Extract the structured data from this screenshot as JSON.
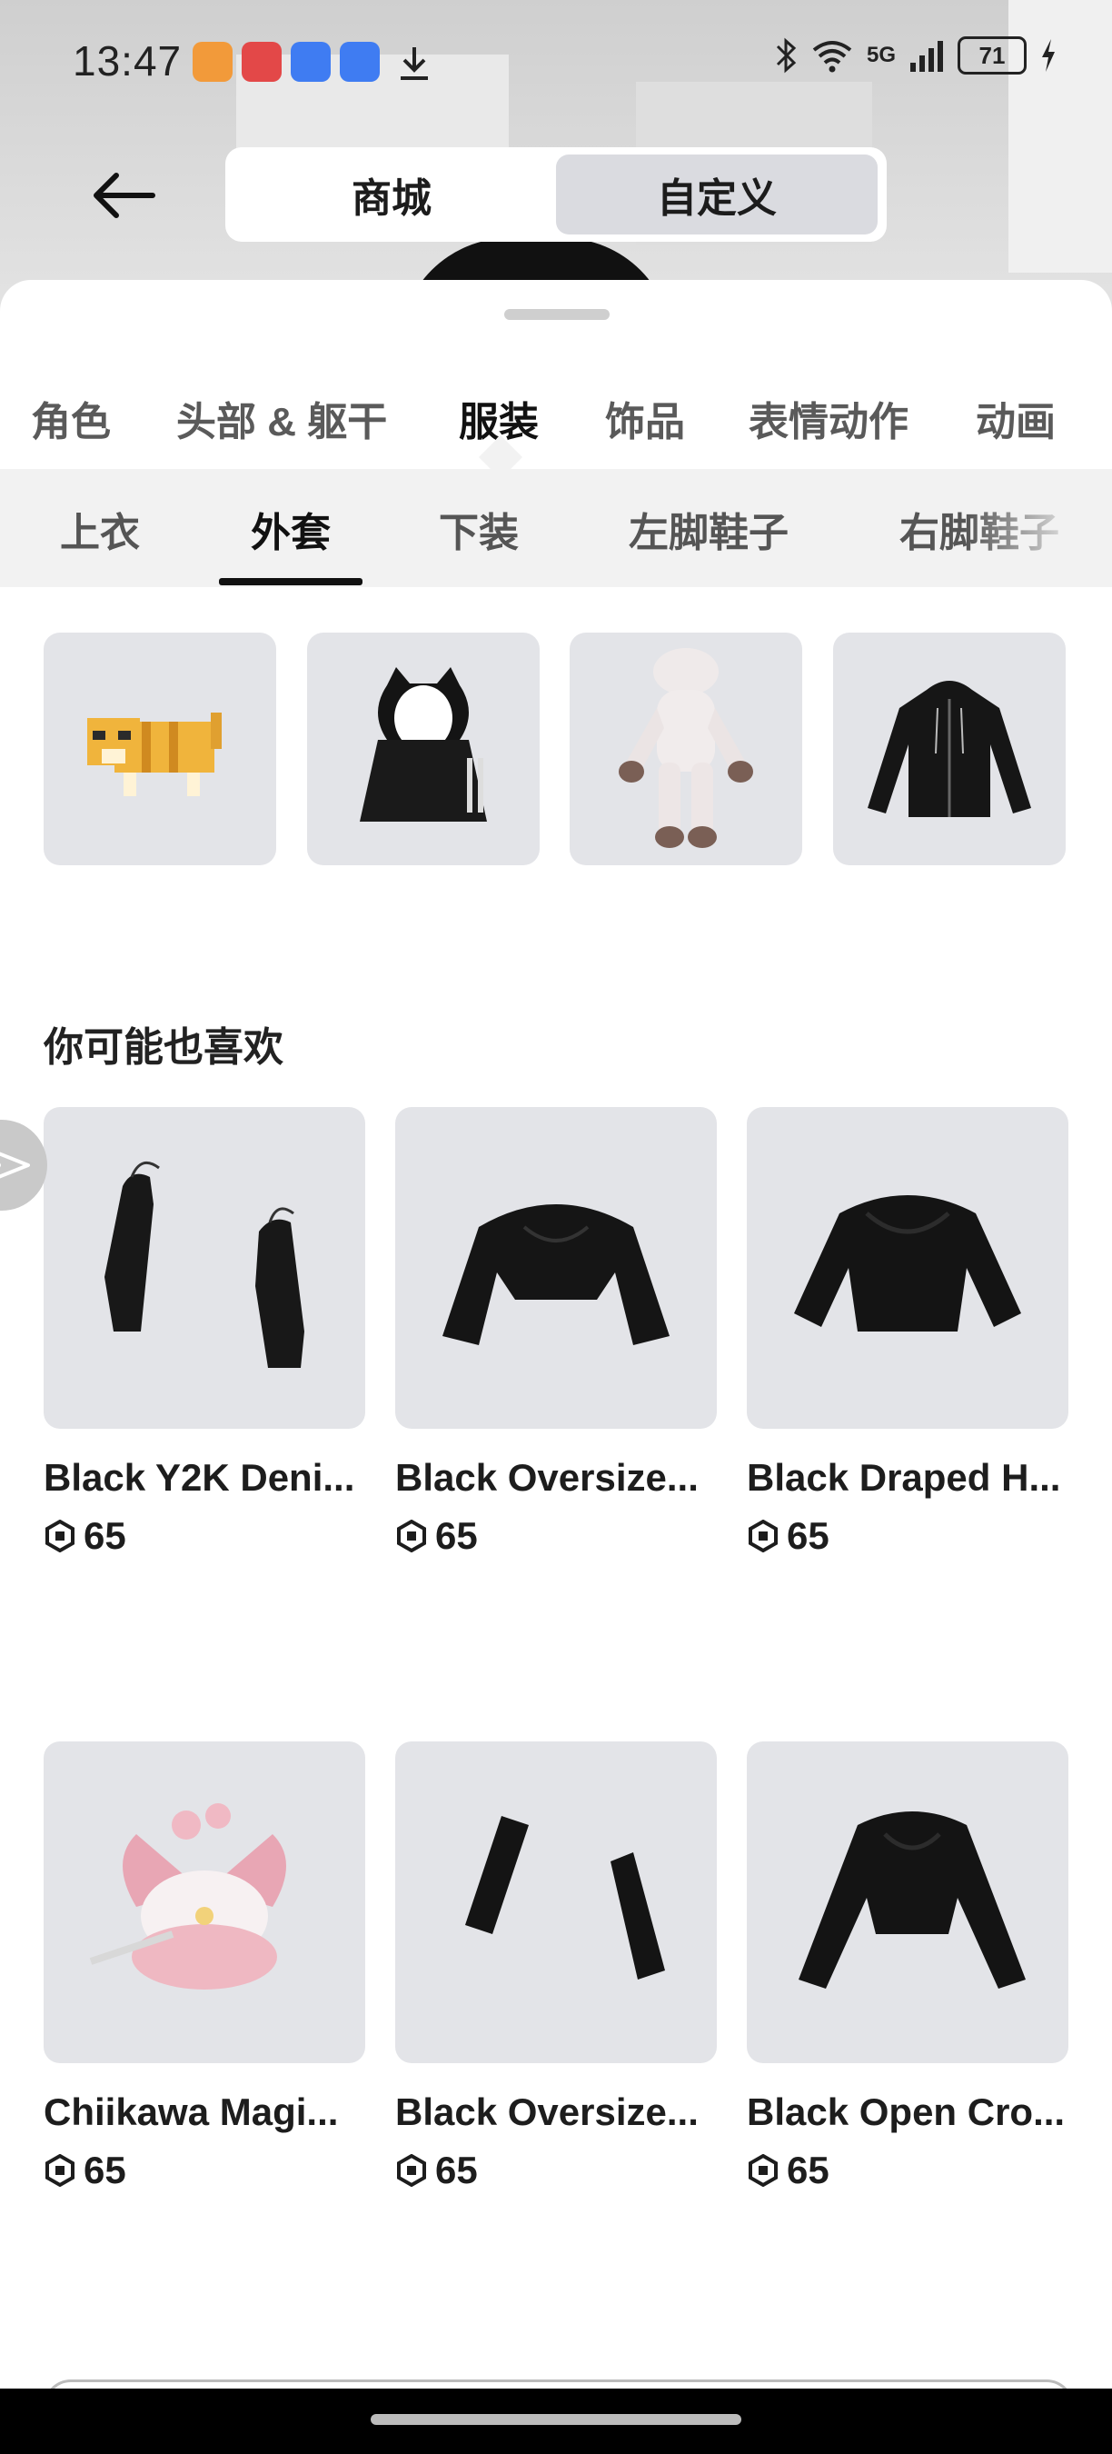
{
  "status_bar": {
    "time": "13:47",
    "signal_label": "5G",
    "battery": "71"
  },
  "header": {
    "tabs": [
      {
        "label": "商城"
      },
      {
        "label": "自定义"
      }
    ]
  },
  "categories": [
    "角色",
    "头部 & 躯干",
    "服装",
    "饰品",
    "表情动作",
    "动画"
  ],
  "subcategories": [
    "上衣",
    "外套",
    "下装",
    "左脚鞋子",
    "右脚鞋子"
  ],
  "owned_items_icons": [
    "cat-costume-icon",
    "black-cat-hoodie-icon",
    "plush-suit-icon",
    "black-zip-hoodie-icon"
  ],
  "recommendations": {
    "title": "你可能也喜欢",
    "items": [
      {
        "name": "Black Y2K Deni...",
        "price": "65"
      },
      {
        "name": "Black Oversize...",
        "price": "65"
      },
      {
        "name": "Black Draped H...",
        "price": "65"
      },
      {
        "name": "Chiikawa Magi...",
        "price": "65"
      },
      {
        "name": "Black Oversize...",
        "price": "65"
      },
      {
        "name": "Black Open Cro...",
        "price": "65"
      }
    ]
  },
  "colors": {
    "accent": "#111111",
    "tile_bg": "#e3e4e8",
    "subnav_bg": "#f2f2f2"
  }
}
